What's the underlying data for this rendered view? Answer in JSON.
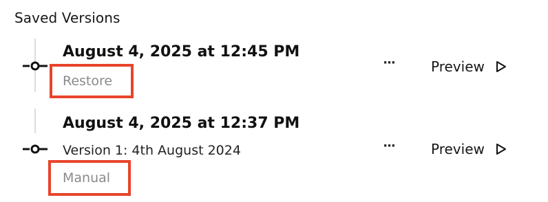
{
  "panel": {
    "title": "Saved Versions"
  },
  "versions": [
    {
      "timestamp": "August 4, 2025 at 12:45 PM",
      "tag": "Restore",
      "more_label": "···",
      "preview_label": "Preview",
      "icons": {
        "node": "commit-node-icon",
        "play": "play-icon"
      }
    },
    {
      "timestamp": "August 4, 2025 at 12:37 PM",
      "description": "Version 1: 4th August 2024",
      "tag": "Manual",
      "more_label": "···",
      "preview_label": "Preview",
      "icons": {
        "node": "commit-node-icon",
        "play": "play-icon"
      }
    }
  ],
  "colors": {
    "highlight": "#e8442a",
    "tag_text": "#8a8a8a",
    "timeline": "#dcdcdc"
  }
}
